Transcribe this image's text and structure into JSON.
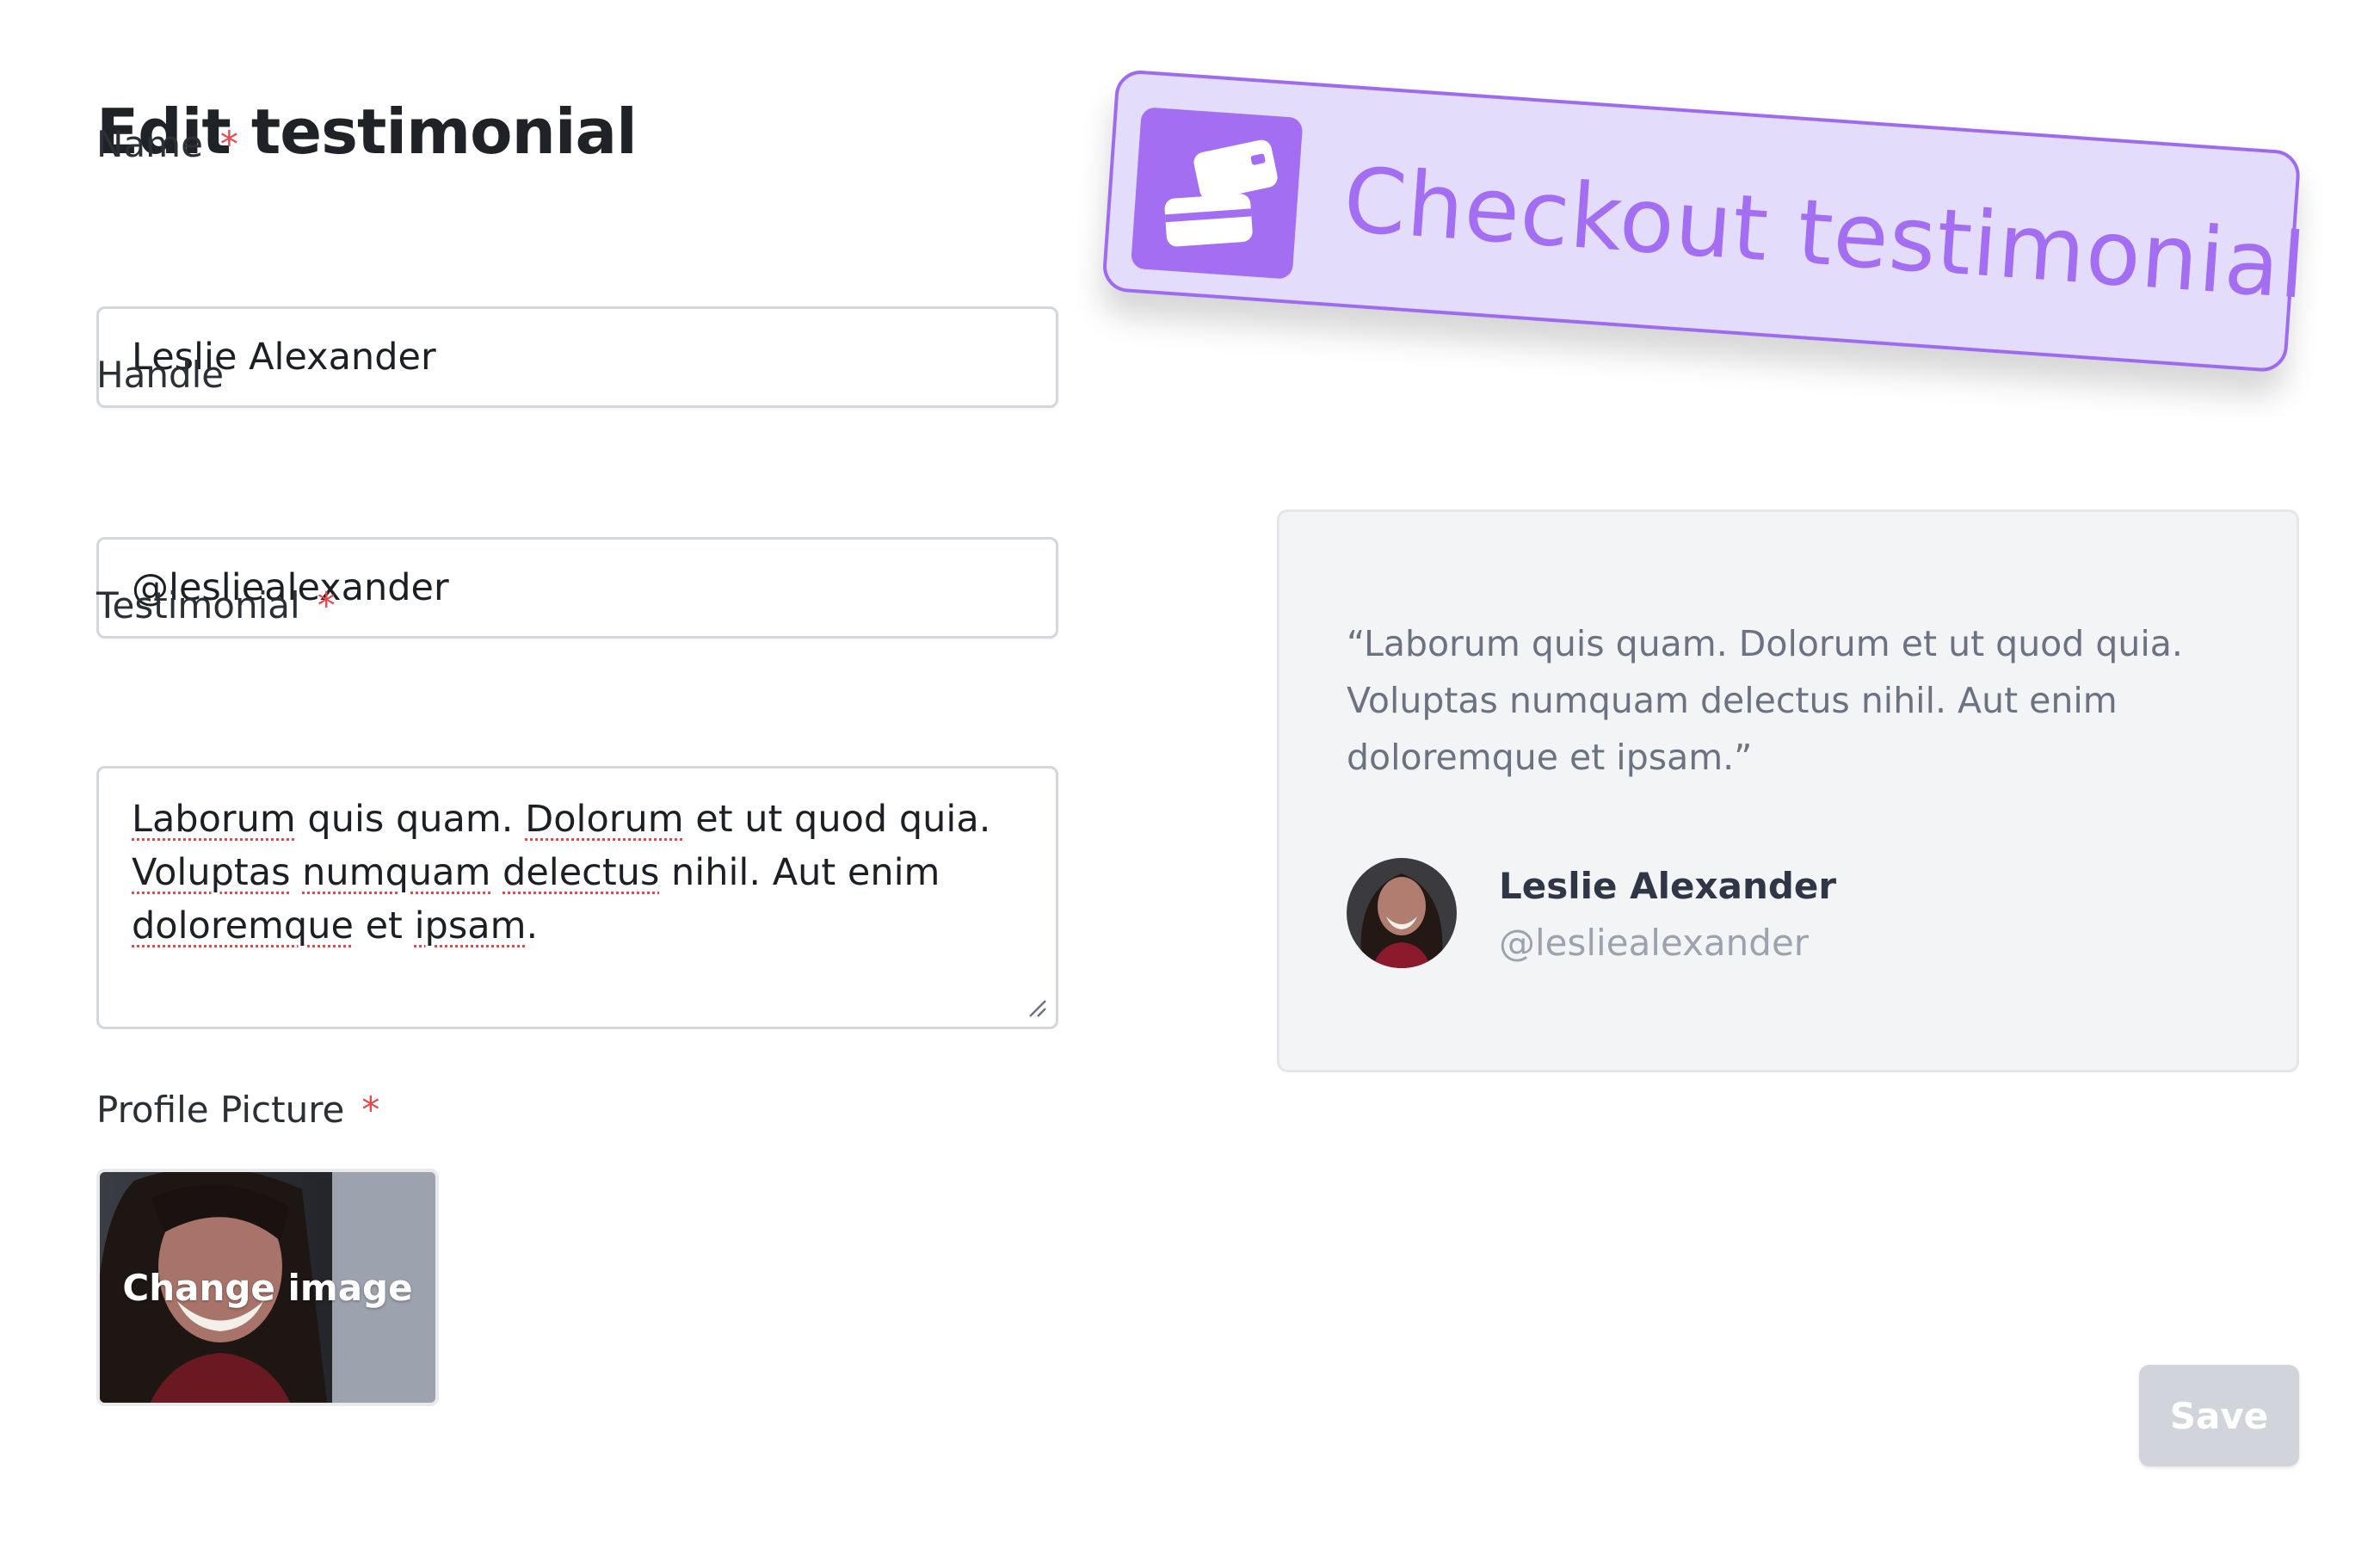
{
  "page": {
    "title": "Edit testimonial"
  },
  "form": {
    "name": {
      "label": "Name",
      "required_mark": "*",
      "value": "Leslie Alexander"
    },
    "handle": {
      "label": "Handle",
      "value": "@lesliealexander"
    },
    "testimonial": {
      "label": "Testimonial",
      "required_mark": "*",
      "value_lines": [
        [
          "Laborum",
          " quis quam. ",
          "Dolorum",
          " et ut quod quia."
        ],
        [
          "Voluptas",
          " ",
          "numquam",
          " ",
          "delectus",
          " nihil. Aut enim"
        ],
        [
          "doloremque",
          " et ",
          "ipsam",
          "."
        ]
      ]
    },
    "profile_picture": {
      "label": "Profile Picture",
      "required_mark": "*",
      "change_label": "Change image"
    }
  },
  "badge": {
    "icon": "credit-cards-icon",
    "text": "Checkout testimonial",
    "color": "#a46ef2"
  },
  "preview": {
    "quote_lines": [
      "“Laborum quis quam. Dolorum et ut quod quia.",
      "Voluptas numquam delectus nihil. Aut enim",
      "doloremque et ipsam.”"
    ],
    "author_name": "Leslie Alexander",
    "author_handle": "@lesliealexander"
  },
  "actions": {
    "save_label": "Save"
  },
  "colors": {
    "required": "#e5484d",
    "accent": "#a46ef2",
    "save_disabled": "#d1d5db"
  }
}
